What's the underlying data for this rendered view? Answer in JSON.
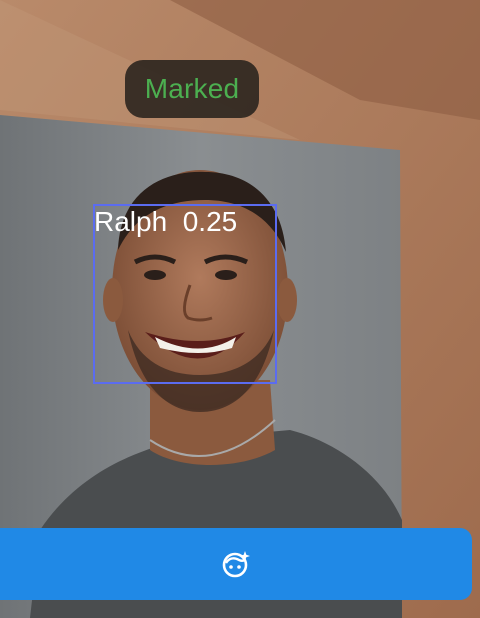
{
  "status": {
    "label": "Marked",
    "color": "#4caf50"
  },
  "detection": {
    "name": "Ralph",
    "score": "0.25",
    "box_color": "#5b6cf0"
  },
  "action_bar": {
    "icon": "face-sparkle-icon",
    "color": "#2089e6"
  }
}
